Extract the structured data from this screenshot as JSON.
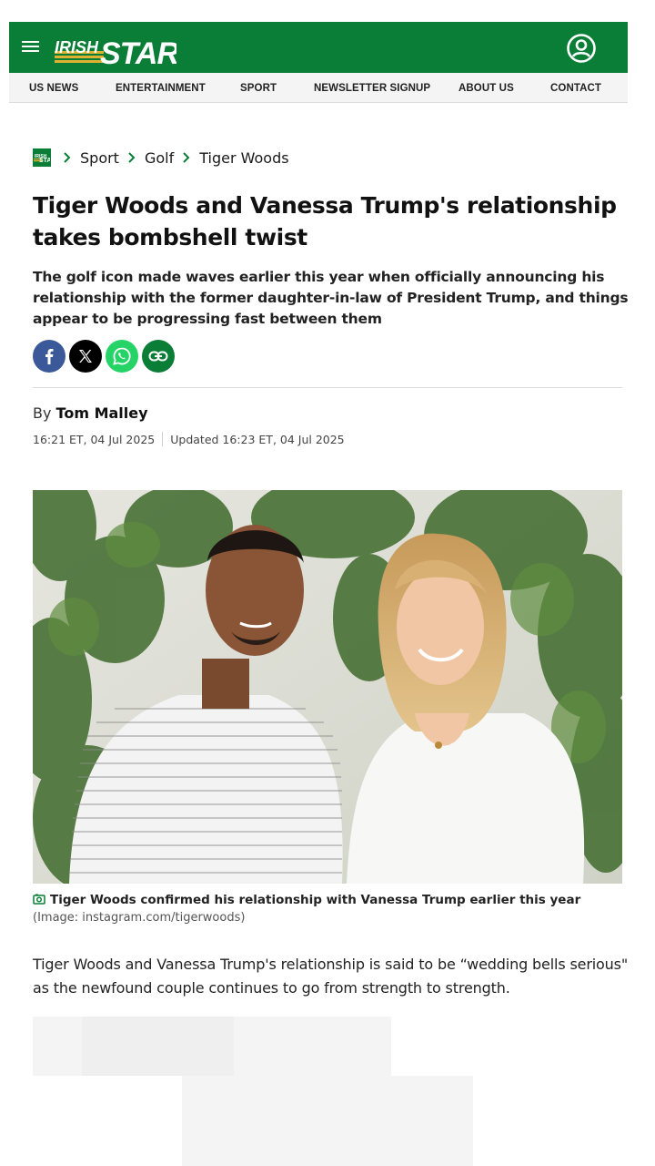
{
  "header": {
    "menu_icon": "hamburger-icon",
    "logo_text_irish": "IRISH",
    "logo_text_star": "STAR",
    "account_icon": "user-circle-icon",
    "brand_color": "#0a7d36"
  },
  "nav": {
    "items": [
      "US NEWS",
      "ENTERTAINMENT",
      "SPORT",
      "NEWSLETTER SIGNUP",
      "ABOUT US",
      "CONTACT"
    ]
  },
  "breadcrumb": {
    "items": [
      "Sport",
      "Golf",
      "Tiger Woods"
    ]
  },
  "article": {
    "headline": "Tiger Woods and Vanessa Trump's relationship takes bombshell twist",
    "standfirst": "The golf icon made waves earlier this year when officially announcing his relationship with the former daughter-in-law of President Trump, and things appear to be progressing fast between them",
    "share": {
      "facebook_icon": "facebook-icon",
      "x_icon": "x-icon",
      "whatsapp_icon": "whatsapp-icon",
      "link_icon": "link-icon"
    },
    "byline_prefix": "By",
    "author": "Tom Malley",
    "published": "16:21 ET, 04 Jul 2025",
    "updated": "Updated 16:23 ET, 04 Jul 2025",
    "image_caption": "Tiger Woods confirmed his relationship with Vanessa Trump earlier this year",
    "image_credit": "(Image: instagram.com/tigerwoods)",
    "first_paragraph": "Tiger Woods and Vanessa Trump's relationship is said to be “wedding bells serious\" as the newfound couple continues to go from strength to strength."
  }
}
